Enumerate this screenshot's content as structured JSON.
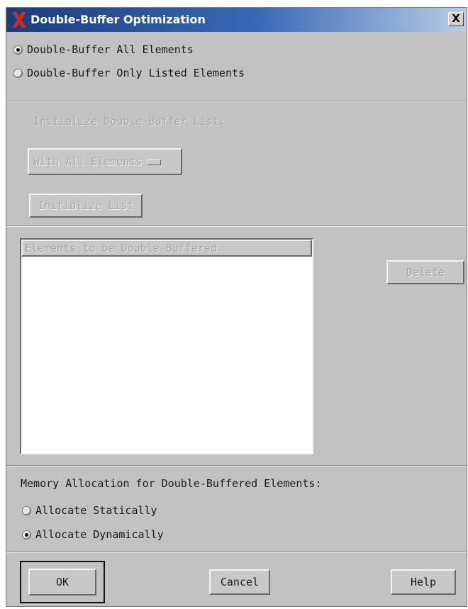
{
  "window": {
    "title": "Double-Buffer Optimization",
    "close_glyph": "X"
  },
  "scope": {
    "options": [
      {
        "label": "Double-Buffer All Elements",
        "selected": true
      },
      {
        "label": "Double-Buffer Only Listed Elements",
        "selected": false
      }
    ]
  },
  "init": {
    "label": "Initialize Double-Buffer List:",
    "option_menu_value": "With All Elements",
    "button_label": "Initialize List",
    "enabled": false
  },
  "list": {
    "header": "Elements to be Double-Buffered",
    "items": [],
    "delete_label": "Delete"
  },
  "memory": {
    "label": "Memory Allocation for Double-Buffered Elements:",
    "options": [
      {
        "label": "Allocate Statically",
        "selected": false
      },
      {
        "label": "Allocate Dynamically",
        "selected": true
      }
    ]
  },
  "footer": {
    "ok_label": "OK",
    "cancel_label": "Cancel",
    "help_label": "Help"
  },
  "colors": {
    "dialog_bg": "#c2c2c2",
    "title_bar": "#1c3d7d",
    "disabled_text": "#a9a9a9"
  }
}
